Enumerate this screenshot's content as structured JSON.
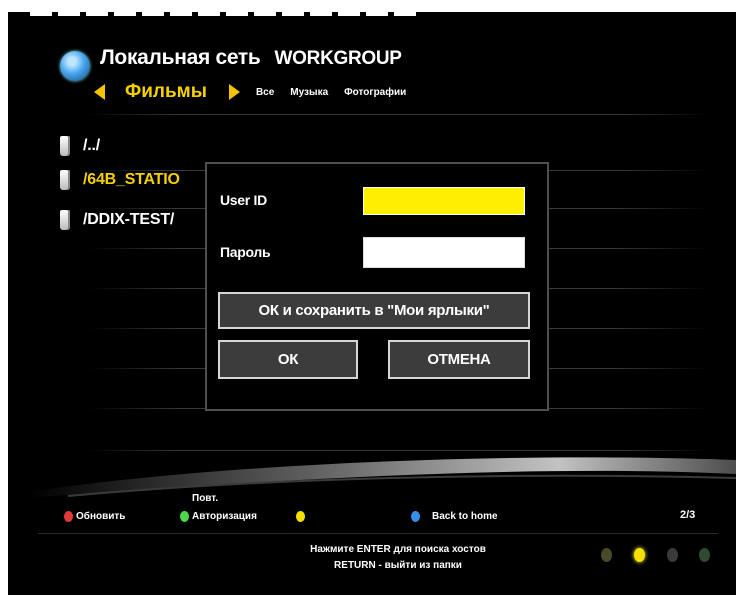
{
  "header": {
    "title": "Локальная сеть",
    "workgroup": "WORKGROUP",
    "active_tab": "Фильмы",
    "tabs": [
      "Все",
      "Музыка",
      "Фотографии"
    ]
  },
  "file_list": [
    {
      "label": "/../",
      "selected": false
    },
    {
      "label": "/64B_STATIO",
      "selected": true
    },
    {
      "label": "/DDIX-TEST/",
      "selected": false
    }
  ],
  "login_dialog": {
    "userid_label": "User ID",
    "password_label": "Пароль",
    "userid_value": "",
    "password_value": "",
    "save_button": "ОК и сохранить в  \"Мои ярлыки\"",
    "ok_button": "ОК",
    "cancel_button": "ОТМЕНА"
  },
  "legend": {
    "refresh": "Обновить",
    "auth_top": "Повт.",
    "auth": "Авторизация",
    "back_home": "Back to home",
    "page": "2/3"
  },
  "hint": {
    "line1": "Нажмите ENTER для поиска хостов",
    "line2": "RETURN - выйти из папки"
  },
  "colors": {
    "accent_yellow": "#f5d000",
    "red": "#e23a3a",
    "green": "#4cd84c",
    "blue": "#3a8ee8",
    "dialog_border": "#4f4f4f"
  },
  "page_dots": {
    "count": 4,
    "active_index": 1
  }
}
